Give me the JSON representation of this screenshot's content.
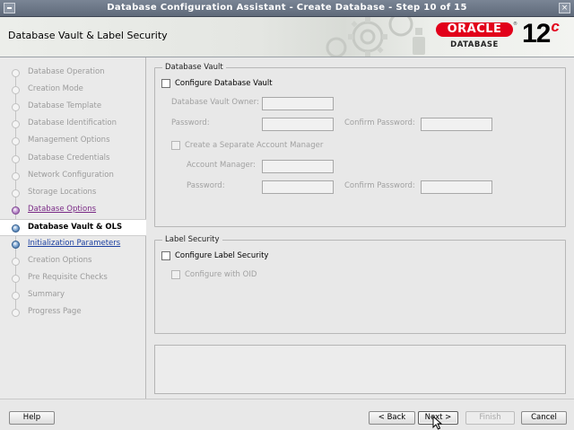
{
  "window": {
    "title": "Database Configuration Assistant - Create Database - Step 10 of 15"
  },
  "header": {
    "page_title": "Database Vault & Label Security",
    "logo_oracle": "ORACLE",
    "logo_database": "DATABASE",
    "logo_version": "12",
    "logo_version_suffix": "c"
  },
  "nav": {
    "steps": [
      {
        "label": "Database Operation",
        "state": "disabled"
      },
      {
        "label": "Creation Mode",
        "state": "disabled"
      },
      {
        "label": "Database Template",
        "state": "disabled"
      },
      {
        "label": "Database Identification",
        "state": "disabled"
      },
      {
        "label": "Management Options",
        "state": "disabled"
      },
      {
        "label": "Database Credentials",
        "state": "disabled"
      },
      {
        "label": "Network Configuration",
        "state": "disabled"
      },
      {
        "label": "Storage Locations",
        "state": "disabled"
      },
      {
        "label": "Database Options",
        "state": "done"
      },
      {
        "label": "Database Vault & OLS",
        "state": "current"
      },
      {
        "label": "Initialization Parameters",
        "state": "next"
      },
      {
        "label": "Creation Options",
        "state": "disabled"
      },
      {
        "label": "Pre Requisite Checks",
        "state": "disabled"
      },
      {
        "label": "Summary",
        "state": "disabled"
      },
      {
        "label": "Progress Page",
        "state": "disabled"
      }
    ]
  },
  "vault": {
    "group_title": "Database Vault",
    "configure_label": "Configure Database Vault",
    "configure_checked": false,
    "owner_label": "Database Vault Owner:",
    "owner_value": "",
    "password_label": "Password:",
    "password_value": "",
    "confirm_password_label": "Confirm Password:",
    "confirm_password_value": "",
    "separate_manager_label": "Create a Separate Account Manager",
    "separate_manager_checked": false,
    "account_manager_label": "Account Manager:",
    "account_manager_value": "",
    "am_password_label": "Password:",
    "am_password_value": "",
    "am_confirm_password_label": "Confirm Password:",
    "am_confirm_password_value": ""
  },
  "label_security": {
    "group_title": "Label Security",
    "configure_label": "Configure Label Security",
    "configure_checked": false,
    "oid_label": "Configure with OID",
    "oid_checked": false
  },
  "footer": {
    "help": "Help",
    "back": "< Back",
    "next": "Next >",
    "finish": "Finish",
    "cancel": "Cancel"
  },
  "colors": {
    "oracle_red": "#e2001a",
    "link_blue": "#1b3fa0",
    "done_purple": "#7a2a86",
    "disabled_text": "#9b9b9b"
  }
}
